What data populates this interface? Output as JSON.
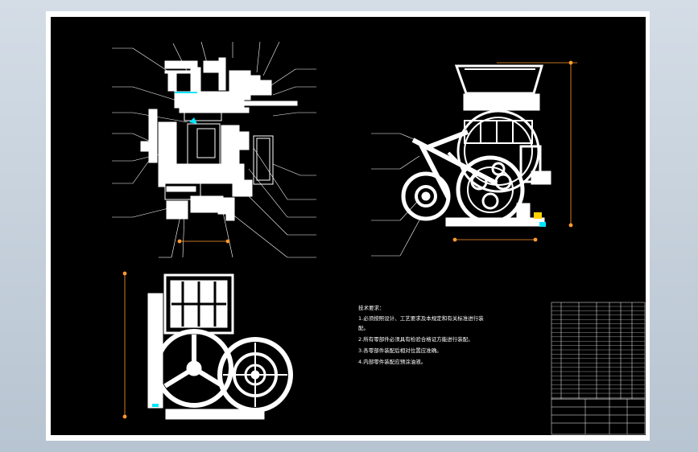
{
  "technical_requirements": {
    "heading": "技术要求：",
    "items": [
      "1.必须按照设计、工艺要求及本规定和有关标准进行装",
      "配。",
      "2.所有零部件必须具有检验合格证方能进行装配。",
      "3.各零部件装配后相对位置应准确。",
      "4.内部零件装配应预涂油液。"
    ]
  },
  "colors": {
    "frame": "#000000",
    "sheet": "#ffffff",
    "line": "#ffffff",
    "dimension": "#ff9a2e",
    "highlight": "#00e5ff",
    "accent": "#ffd200"
  },
  "icons": {
    "front_view": "machine-front-view",
    "side_view": "machine-side-view",
    "top_view": "machine-top-view"
  }
}
